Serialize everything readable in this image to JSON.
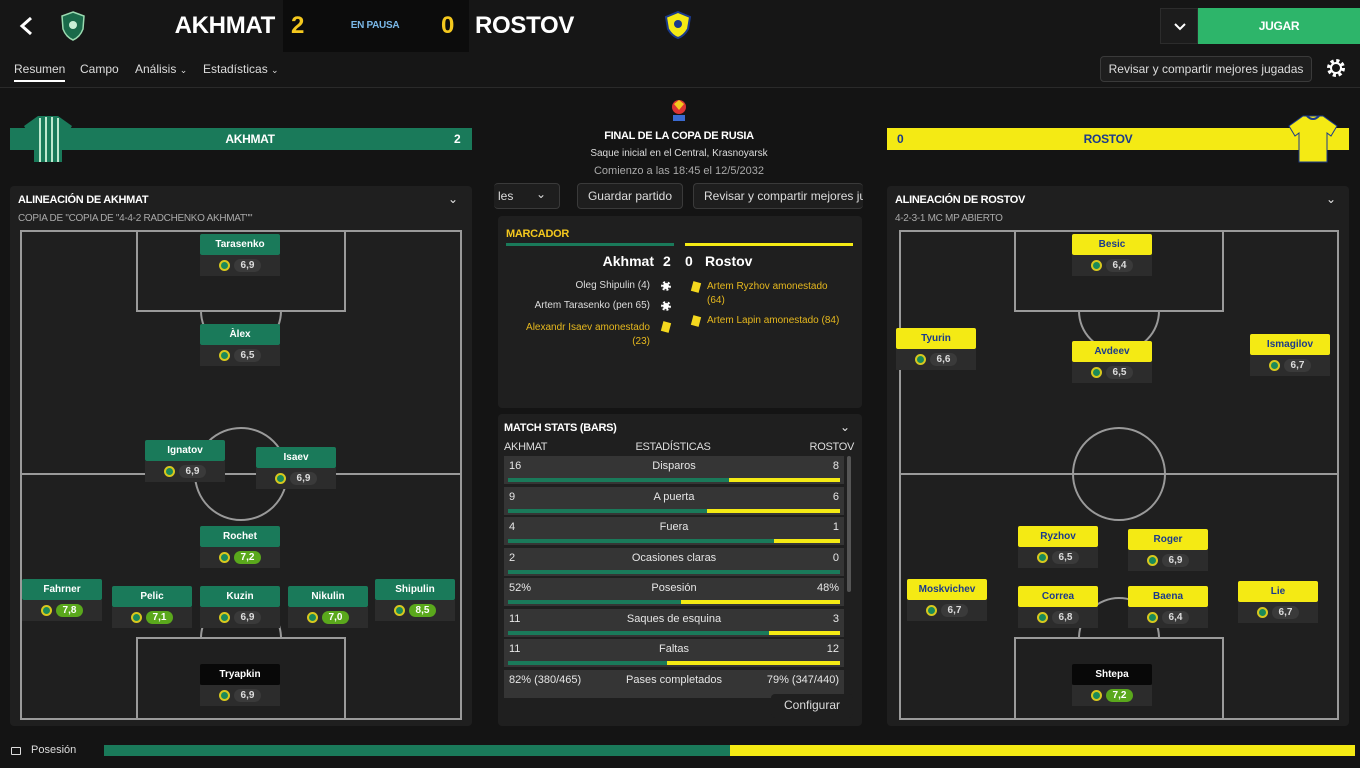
{
  "header": {
    "home_team": "AKHMAT",
    "home_score": "2",
    "status": "EN PAUSA",
    "away_score": "0",
    "away_team": "ROSTOV",
    "play_label": "JUGAR"
  },
  "tabs": [
    "Resumen",
    "Campo",
    "Análisis",
    "Estadísticas"
  ],
  "review_button": "Revisar y compartir mejores jugadas",
  "colors": {
    "home": "#1a7a5a",
    "away": "#f4ea14",
    "accent": "#2db56a"
  },
  "home_banner": {
    "team": "AKHMAT",
    "score": "2"
  },
  "away_banner": {
    "team": "ROSTOV",
    "score": "0"
  },
  "match_info": {
    "competition": "FINAL DE LA COPA DE RUSIA",
    "venue": "Saque inicial en el Central, Krasnoyarsk",
    "kickoff": "Comienzo a las 18:45 el 12/5/2032"
  },
  "center_buttons": {
    "left": "les",
    "save": "Guardar partido",
    "review": "Revisar y compartir mejores ju"
  },
  "home_lineup": {
    "title": "ALINEACIÓN DE AKHMAT",
    "formation": "COPIA DE \"COPIA DE \"4-4-2 RADCHENKO AKHMAT\"\"",
    "players": [
      {
        "name": "Tarasenko",
        "rating": "6,9"
      },
      {
        "name": "Àlex",
        "rating": "6,5"
      },
      {
        "name": "Ignatov",
        "rating": "6,9"
      },
      {
        "name": "Isaev",
        "rating": "6,9"
      },
      {
        "name": "Rochet",
        "rating": "7,2"
      },
      {
        "name": "Fahrner",
        "rating": "7,8"
      },
      {
        "name": "Pelic",
        "rating": "7,1"
      },
      {
        "name": "Kuzin",
        "rating": "6,9"
      },
      {
        "name": "Nikulin",
        "rating": "7,0"
      },
      {
        "name": "Shipulin",
        "rating": "8,5"
      },
      {
        "name": "Tryapkin",
        "rating": "6,9"
      }
    ]
  },
  "away_lineup": {
    "title": "ALINEACIÓN DE ROSTOV",
    "formation": "4-2-3-1 MC MP ABIERTO",
    "players": [
      {
        "name": "Besic",
        "rating": "6,4"
      },
      {
        "name": "Tyurin",
        "rating": "6,6"
      },
      {
        "name": "Avdeev",
        "rating": "6,5"
      },
      {
        "name": "Ismagilov",
        "rating": "6,7"
      },
      {
        "name": "Ryzhov",
        "rating": "6,5"
      },
      {
        "name": "Roger",
        "rating": "6,9"
      },
      {
        "name": "Moskvichev",
        "rating": "6,7"
      },
      {
        "name": "Correa",
        "rating": "6,8"
      },
      {
        "name": "Baena",
        "rating": "6,4"
      },
      {
        "name": "Lie",
        "rating": "6,7"
      },
      {
        "name": "Shtepa",
        "rating": "7,2"
      }
    ]
  },
  "scoreboard": {
    "title": "MARCADOR",
    "home": "Akhmat",
    "home_score": "2",
    "away_score": "0",
    "away": "Rostov",
    "home_events": [
      "Oleg Shipulin (4)",
      "Artem Tarasenko (pen 65)",
      "Alexandr Isaev amonestado (23)"
    ],
    "away_events": [
      "Artem Ryzhov amonestado (64)",
      "Artem Lapin amonestado (84)"
    ]
  },
  "stats": {
    "title": "MATCH STATS (BARS)",
    "home": "AKHMAT",
    "mid": "ESTADÍSTICAS",
    "away": "ROSTOV",
    "rows": [
      {
        "home": "16",
        "label": "Disparos",
        "away": "8",
        "share": 0.667
      },
      {
        "home": "9",
        "label": "A puerta",
        "away": "6",
        "share": 0.6
      },
      {
        "home": "4",
        "label": "Fuera",
        "away": "1",
        "share": 0.8
      },
      {
        "home": "2",
        "label": "Ocasiones claras",
        "away": "0",
        "share": 1.0
      },
      {
        "home": "52%",
        "label": "Posesión",
        "away": "48%",
        "share": 0.52
      },
      {
        "home": "11",
        "label": "Saques de esquina",
        "away": "3",
        "share": 0.786
      },
      {
        "home": "11",
        "label": "Faltas",
        "away": "12",
        "share": 0.478
      },
      {
        "home": "82% (380/465)",
        "label": "Pases completados",
        "away": "79% (347/440)"
      }
    ]
  },
  "configure": "Configurar",
  "footer": {
    "label": "Posesión",
    "home_share": 0.5
  }
}
